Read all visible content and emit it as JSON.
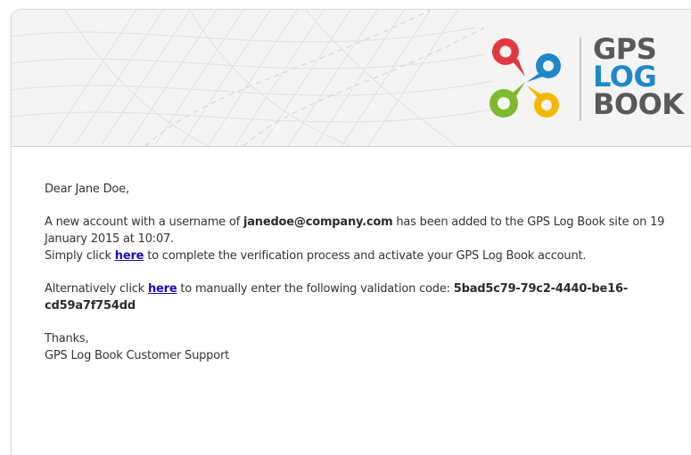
{
  "logo": {
    "line1": "GPS",
    "line2": "LOG",
    "line3": "BOOK",
    "colors": {
      "dark": "#58595b",
      "blue": "#1e88c8",
      "red": "#e03a3e",
      "green": "#7dba2f",
      "yellow": "#f5b800"
    }
  },
  "email": {
    "greeting": "Dear Jane Doe,",
    "p1_before": "A new account with a username of ",
    "username": "janedoe@company.com",
    "p1_after": " has been added to the GPS Log Book site on 19 January 2015 at 10:07.",
    "p2_before": "Simply click ",
    "p2_link": "here",
    "p2_after": " to complete the verification process and activate your GPS Log Book account.",
    "p3_before": "Alternatively click ",
    "p3_link": "here",
    "p3_after": " to manually enter the following validation code: ",
    "validation_code": "5bad5c79-79c2-4440-be16-cd59a7f754dd",
    "thanks": "Thanks,",
    "signature": "GPS Log Book Customer Support"
  }
}
